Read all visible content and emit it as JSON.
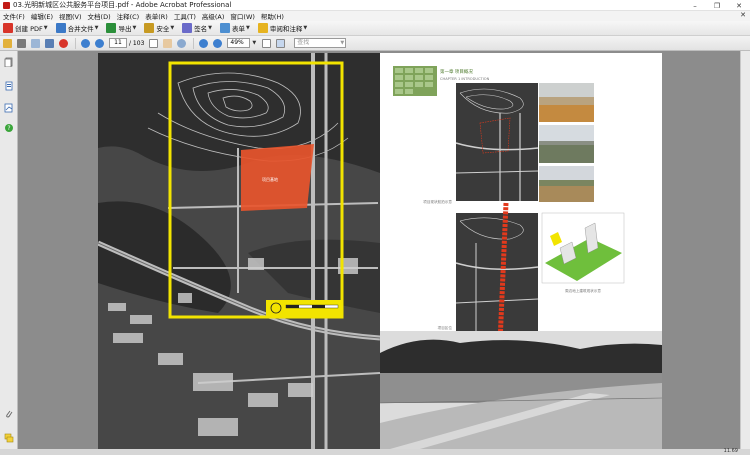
{
  "window": {
    "title": "03.光明新城区公共服务平台项目.pdf - Adobe Acrobat Professional",
    "controls": [
      "–",
      "❐",
      "✕"
    ]
  },
  "menu": {
    "items": [
      "文件(F)",
      "编辑(E)",
      "视图(V)",
      "文档(D)",
      "注释(C)",
      "表单(R)",
      "工具(T)",
      "高级(A)",
      "窗口(W)",
      "帮助(H)"
    ],
    "close": "✕"
  },
  "toolbar1": {
    "buttons": [
      {
        "label": "创建 PDF",
        "icon": "create-pdf-icon",
        "color": "#d8352a"
      },
      {
        "label": "合并文件",
        "icon": "combine-files-icon",
        "color": "#3b79c7"
      },
      {
        "label": "导出",
        "icon": "export-icon",
        "color": "#2b8f3a"
      },
      {
        "label": "安全",
        "icon": "lock-icon",
        "color": "#c79a22"
      },
      {
        "label": "签名",
        "icon": "sign-pen-icon",
        "color": "#6a6ac9"
      },
      {
        "label": "表单",
        "icon": "form-icon",
        "color": "#4d8fd1"
      },
      {
        "label": "审阅和注释",
        "icon": "review-comment-icon",
        "color": "#e6b320"
      }
    ]
  },
  "toolbar2": {
    "page_current": "11",
    "page_total": "/ 103",
    "zoom": "49%",
    "search_placeholder": "查找"
  },
  "status": {
    "zoom_text": "11.69"
  },
  "document": {
    "left_page": {
      "site_label": "项目基地"
    },
    "right_page": {
      "chapter_title": "第一章 项目概况",
      "chapter_subtitle": "CHAPTER 1 INTRODUCTION",
      "caption_aerial": "项目现状航拍示意",
      "caption_location": "项目区位",
      "caption_3d": "周边地上建筑现状示意"
    }
  },
  "colors": {
    "site_orange": "#e8552c",
    "yellow_boundary": "#f2e400",
    "green_theme": "#7fa35a",
    "rail_red": "#e2391c"
  }
}
